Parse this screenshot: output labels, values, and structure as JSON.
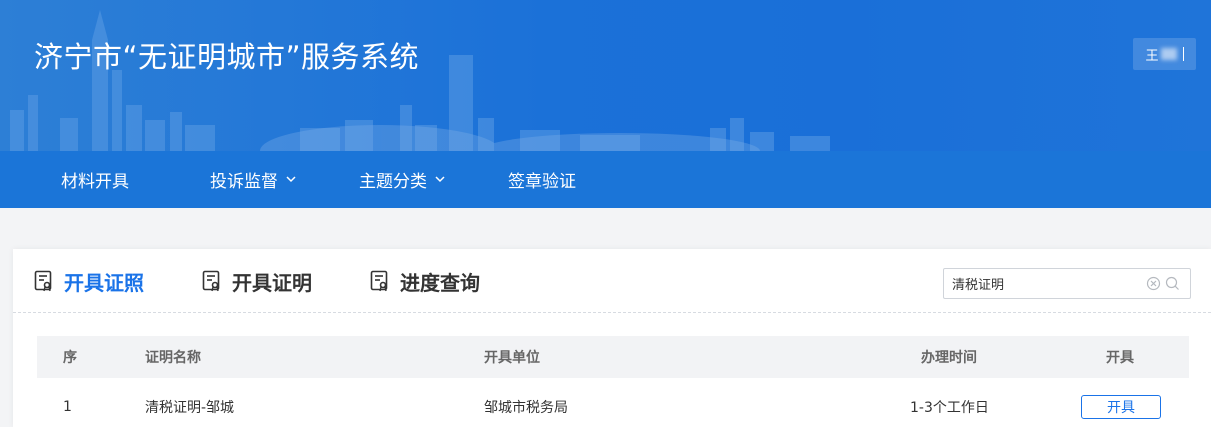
{
  "header": {
    "title": "济宁市“无证明城市”服务系统",
    "user_name": "王"
  },
  "nav": {
    "items": [
      {
        "label": "材料开具"
      },
      {
        "label": "投诉监督"
      },
      {
        "label": "主题分类"
      },
      {
        "label": "签章验证"
      }
    ]
  },
  "tabs": [
    {
      "label": "开具证照",
      "active": true
    },
    {
      "label": "开具证明",
      "active": false
    },
    {
      "label": "进度查询",
      "active": false
    }
  ],
  "search": {
    "value": "清税证明"
  },
  "table": {
    "columns": [
      "序",
      "证明名称",
      "开具单位",
      "办理时间",
      "开具"
    ],
    "rows": [
      {
        "index": "1",
        "name": "清税证明-邹城",
        "unit": "邹城市税务局",
        "time": "1-3个工作日",
        "action": "开具"
      }
    ]
  },
  "colors": {
    "header_blue": "#1b71d8",
    "nav_blue": "#1b75d8",
    "accent": "#1a73e8"
  }
}
